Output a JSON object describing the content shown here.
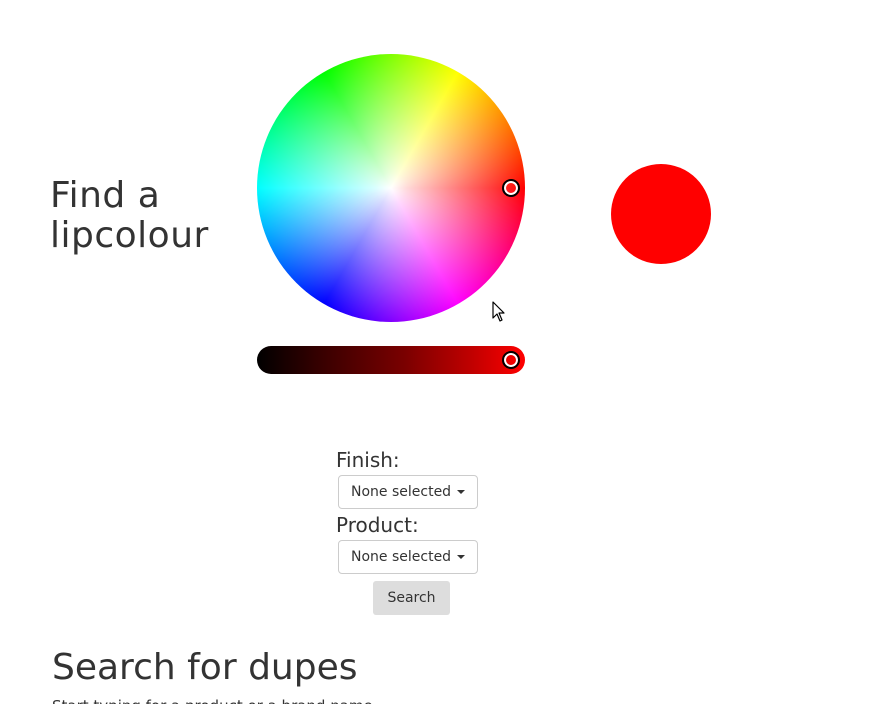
{
  "picker": {
    "heading": "Find a lipcolour",
    "selected_color": "#ff0000"
  },
  "filters": {
    "finish_label": "Finish:",
    "finish_value": "None selected",
    "product_label": "Product:",
    "product_value": "None selected",
    "search_label": "Search"
  },
  "dupes": {
    "title": "Search for dupes",
    "description": "Start typing for a product or a brand name"
  },
  "icons": {
    "mouse_pointer": "arrow-cursor-icon",
    "dropdown_caret": "caret-down-icon"
  }
}
